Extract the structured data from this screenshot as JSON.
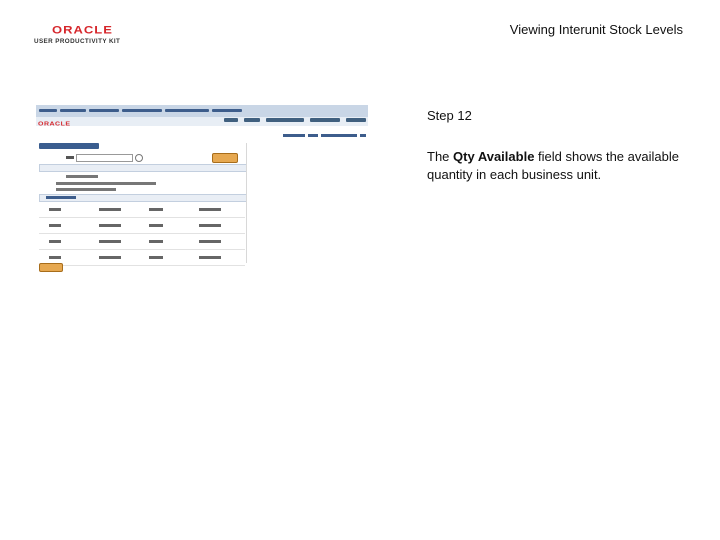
{
  "logo": {
    "brand": "ORACLE",
    "product": "USER PRODUCTIVITY KIT"
  },
  "header": {
    "title": "Viewing Interunit Stock Levels"
  },
  "thumbnail": {
    "oracle_text": "ORACLE",
    "rows": 4
  },
  "step": {
    "label": "Step 12"
  },
  "instruction": {
    "prefix": "The ",
    "field": "Qty Available",
    "suffix": " field shows the available quantity in each business unit."
  },
  "colors": {
    "brand": "#d6262b",
    "nav": "#c9d6e6",
    "button": "#e6a850",
    "link": "#3d5d8c"
  }
}
